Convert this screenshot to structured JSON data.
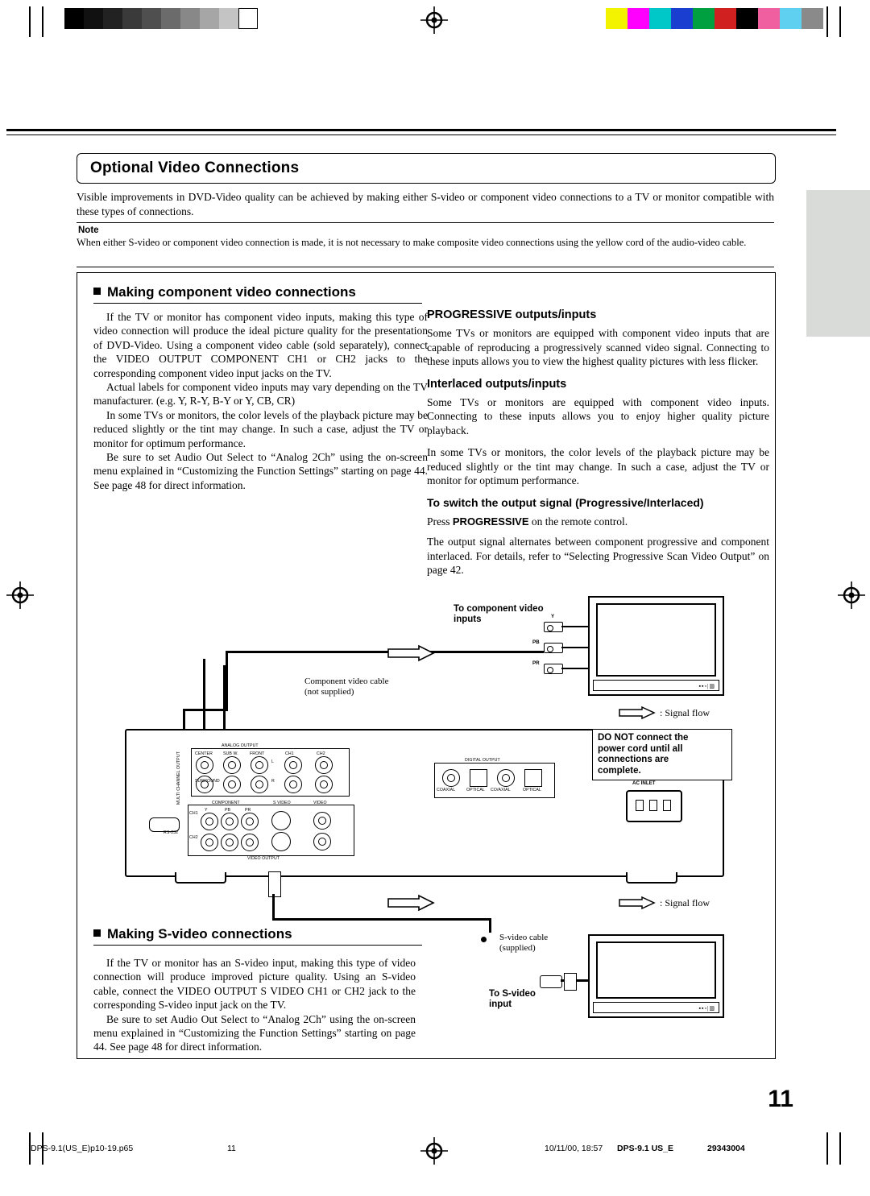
{
  "header": {
    "title": "Optional Video Connections",
    "intro": "Visible improvements in DVD-Video quality can be achieved by making either S-video or component video connections to a TV or monitor compatible with these types of connections."
  },
  "note": {
    "label": "Note",
    "text": "When either S-video or component video connection is made, it is not necessary to make composite video connections using the yellow cord of the audio-video cable."
  },
  "section_component": {
    "heading": "Making component video connections",
    "p1": "If the TV or monitor has component video inputs, making this type of video connection will produce the ideal picture quality for the presentation of DVD-Video. Using a component video cable (sold separately), connect the VIDEO OUTPUT COMPONENT CH1 or CH2 jacks to the corresponding component video input jacks on the TV.",
    "p2": "Actual labels for component video inputs may vary depending on the TV manufacturer. (e.g. Y, R-Y, B-Y or Y, CB, CR)",
    "p3": "In some TVs or monitors, the color levels of the playback picture may be reduced slightly or the tint may change. In such a case, adjust the TV or monitor for optimum performance.",
    "p4": "Be sure to set Audio Out Select to “Analog 2Ch” using the on-screen menu explained in “Customizing the Function Settings” starting on page 44. See page 48 for direct information."
  },
  "section_progressive": {
    "heading": "PROGRESSIVE outputs/inputs",
    "p1": "Some TVs or monitors are equipped with component video inputs that are capable of reproducing a progressively scanned video signal. Connecting to these inputs allows you to view the highest quality pictures with less flicker."
  },
  "section_interlaced": {
    "heading": "Interlaced outputs/inputs",
    "p1": "Some TVs or monitors are equipped with component video inputs. Connecting to these inputs allows you to enjoy higher quality picture playback.",
    "p2": "In some TVs or monitors, the color levels of the playback picture may be reduced slightly or the tint may change. In such a case, adjust the TV or monitor for optimum performance."
  },
  "section_switch": {
    "heading": "To switch the output signal (Progressive/Interlaced)",
    "p1_pre": "Press ",
    "p1_bold": "PROGRESSIVE",
    "p1_post": " on the remote control.",
    "p2": "The output signal alternates between component progressive and component interlaced. For details, refer to “Selecting Progressive Scan Video Output” on page 42."
  },
  "section_svideo": {
    "heading": "Making S-video connections",
    "p1": "If the TV or monitor has an S-video input, making this type of video connection will produce improved picture quality. Using an S-video cable, connect the VIDEO OUTPUT S VIDEO CH1 or CH2 jack to the corresponding S-video input jack on the TV.",
    "p2": "Be sure to set Audio Out Select to “Analog 2Ch” using the on-screen menu explained in “Customizing the Function Settings” starting on page 44. See page 48 for direct information."
  },
  "diagram": {
    "to_component_inputs": "To component video\ninputs",
    "to_component_inputs_l1": "To component video",
    "to_component_inputs_l2": "inputs",
    "y_label": "Y",
    "pb_label": "PB",
    "pr_label": "PR",
    "component_cable_l1": "Component video cable",
    "component_cable_l2": "(not supplied)",
    "signal_flow": ": Signal flow",
    "warning_l1": "DO NOT connect the",
    "warning_l2": "power cord until all",
    "warning_l3": "connections are",
    "warning_l4": "complete.",
    "ac_inlet": "AC INLET",
    "svideo_cable_l1": "S-video cable",
    "svideo_cable_l2": "(supplied)",
    "to_svideo_l1": "To S-video",
    "to_svideo_l2": "input",
    "panel": {
      "multi_channel_output": "MULTI CHANNEL OUTPUT",
      "analog_output": "ANALOG OUTPUT",
      "center": "CENTER",
      "subwoofer": "SUB W.",
      "front": "FRONT",
      "surround": "SURROUND",
      "ch1": "CH1",
      "ch2": "CH2",
      "l": "L",
      "r": "R",
      "digital_output": "DIGITAL OUTPUT",
      "coaxial": "COAXIAL",
      "optical": "OPTICAL",
      "co_ax": "CO/AXIAL",
      "optical2": "OPTICAL",
      "component": "COMPONENT",
      "s_video": "S VIDEO",
      "video": "VIDEO",
      "video_output": "VIDEO OUTPUT",
      "rs232": "RS-232",
      "y": "Y",
      "pb": "PB",
      "pr": "PR"
    }
  },
  "footer": {
    "file": "DPS-9.1(US_E)p10-19.p65",
    "page_small": "11",
    "date": "10/11/00, 18:57",
    "model": "DPS-9.1 US_E",
    "code": "29343004",
    "page_number": "11"
  },
  "colors": {
    "grey_ramp": [
      "#000000",
      "#0d0d0d",
      "#1f1f1f",
      "#333333",
      "#4d4d4d",
      "#666666",
      "#808080",
      "#999999",
      "#b3b3b3",
      "#cccccc",
      "#ffffff"
    ],
    "color_ramp": [
      "#f3f300",
      "#ff00ff",
      "#00c8c8",
      "#1a3fd0",
      "#00a040",
      "#d02020",
      "#000000",
      "#f060a0",
      "#60d0f0",
      "#8a8a8a"
    ],
    "side_tab": "#d8dbd8"
  }
}
